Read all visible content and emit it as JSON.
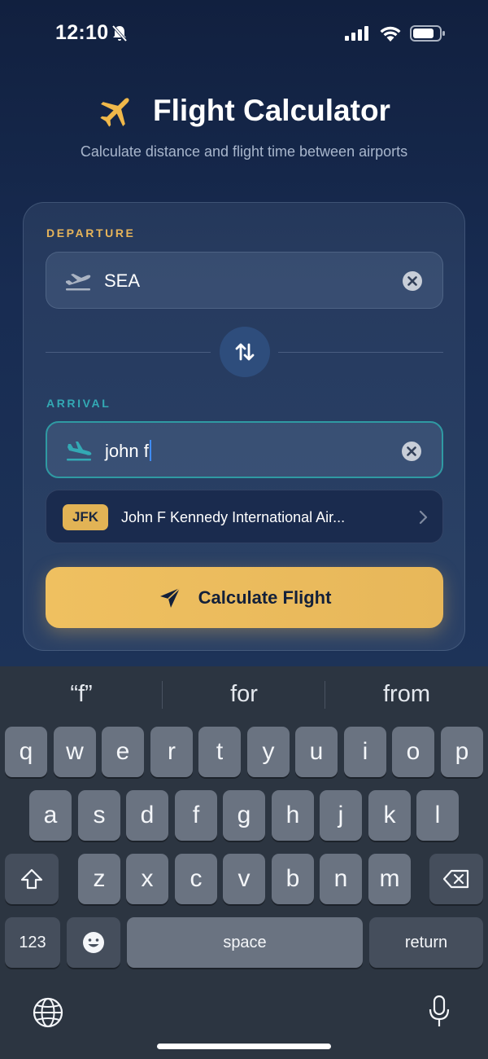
{
  "status_bar": {
    "time": "12:10"
  },
  "header": {
    "title": "Flight Calculator",
    "subtitle": "Calculate distance and flight time between airports"
  },
  "form": {
    "departure_label": "DEPARTURE",
    "departure_value": "SEA",
    "arrival_label": "ARRIVAL",
    "arrival_value": "john f",
    "suggestion": {
      "code": "JFK",
      "name": "John F Kennedy International Air..."
    },
    "calculate_label": "Calculate Flight"
  },
  "keyboard": {
    "predictions": [
      "“f”",
      "for",
      "from"
    ],
    "row1": [
      "q",
      "w",
      "e",
      "r",
      "t",
      "y",
      "u",
      "i",
      "o",
      "p"
    ],
    "row2": [
      "a",
      "s",
      "d",
      "f",
      "g",
      "h",
      "j",
      "k",
      "l"
    ],
    "row3": [
      "z",
      "x",
      "c",
      "v",
      "b",
      "n",
      "m"
    ],
    "numbers_label": "123",
    "space_label": "space",
    "return_label": "return"
  },
  "colors": {
    "accent_gold": "#e6b45a",
    "accent_teal": "#33a9b4",
    "background": "#142444"
  }
}
